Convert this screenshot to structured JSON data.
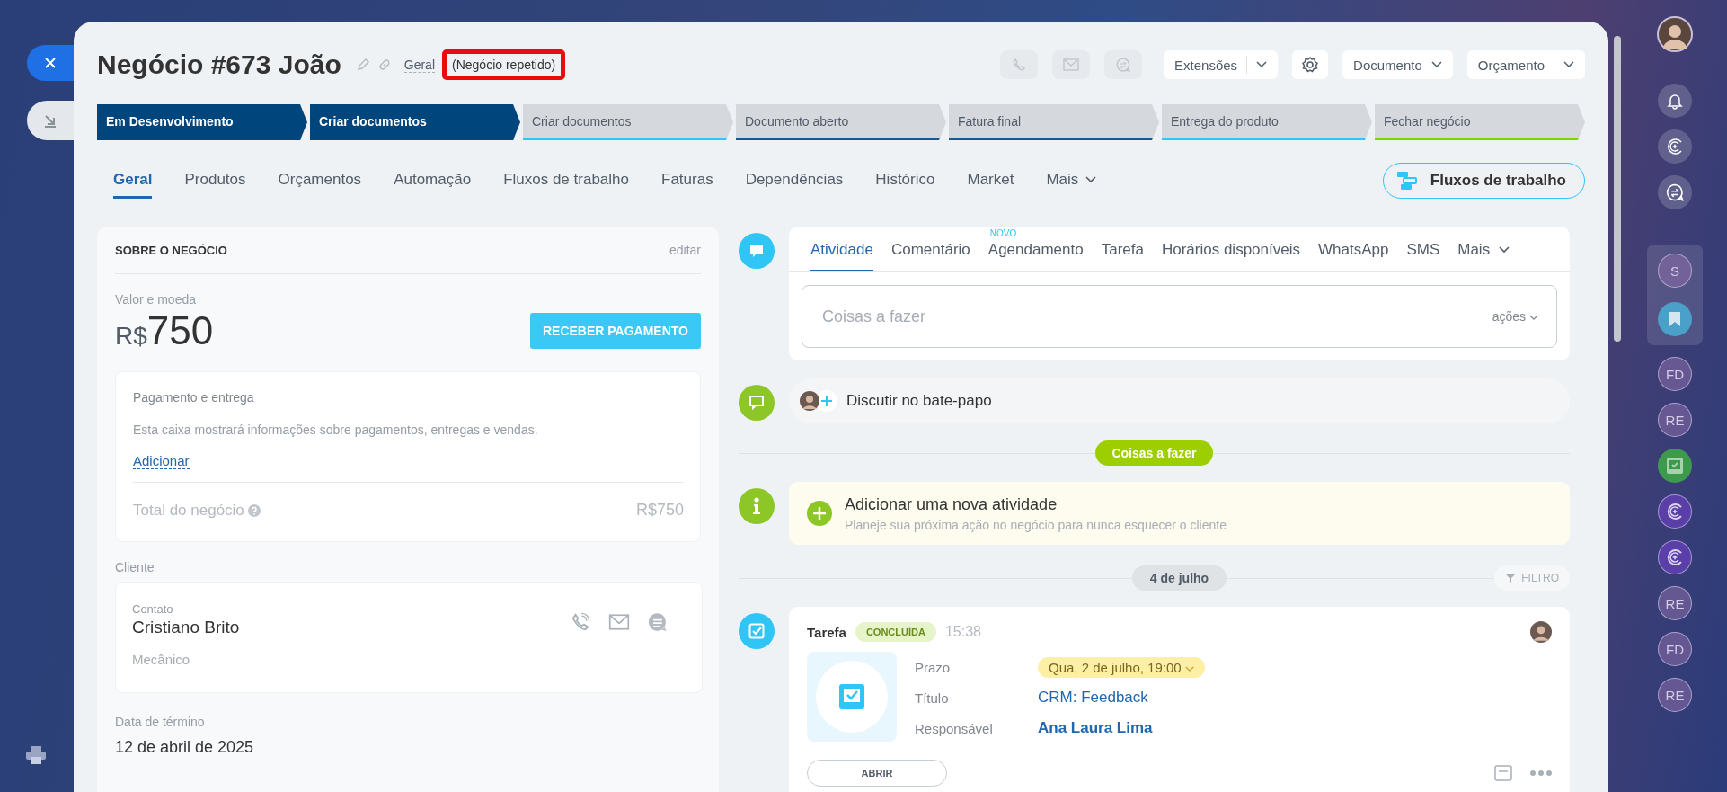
{
  "deal": {
    "title": "Negócio #673 João",
    "category": "Geral",
    "repeat_label": "(Negócio repetido)"
  },
  "header_actions": [
    {
      "kind": "phone",
      "disabled": true
    },
    {
      "kind": "mail",
      "disabled": true
    },
    {
      "kind": "chat",
      "disabled": true
    }
  ],
  "header_buttons": [
    {
      "kind": "split",
      "label": "Extensões"
    },
    {
      "kind": "gear"
    },
    {
      "kind": "dropdown",
      "label": "Documento"
    },
    {
      "kind": "split",
      "label": "Orçamento"
    }
  ],
  "stages": [
    {
      "label": "Em Desenvolvimento",
      "filled": true,
      "color": "#00457c"
    },
    {
      "label": "Criar documentos",
      "filled": true,
      "color": "#00457c"
    },
    {
      "label": "Criar documentos",
      "filled": false,
      "color": "#2fc6f6"
    },
    {
      "label": "Documento aberto",
      "filled": false,
      "color": "#1c5a8c"
    },
    {
      "label": "Fatura final",
      "filled": false,
      "color": "#1c5a8c"
    },
    {
      "label": "Entrega do produto",
      "filled": false,
      "color": "#2fc6f6"
    },
    {
      "label": "Fechar negócio",
      "filled": false,
      "color": "#7bd500"
    }
  ],
  "tabs": [
    {
      "label": "Geral",
      "selected": true
    },
    {
      "label": "Produtos",
      "selected": false
    },
    {
      "label": "Orçamentos",
      "selected": false
    },
    {
      "label": "Automação",
      "selected": false
    },
    {
      "label": "Fluxos de trabalho",
      "selected": false
    },
    {
      "label": "Faturas",
      "selected": false
    },
    {
      "label": "Dependências",
      "selected": false
    },
    {
      "label": "Histórico",
      "selected": false
    },
    {
      "label": "Market",
      "selected": false
    },
    {
      "label": "Mais",
      "selected": false
    }
  ],
  "workflows_button": "Fluxos de trabalho",
  "about": {
    "heading": "SOBRE O NEGÓCIO",
    "edit": "editar",
    "amount_label": "Valor e moeda",
    "currency": "R$",
    "amount": "750",
    "pay_button": "RECEBER PAGAMENTO",
    "payment": {
      "title": "Pagamento e entrega",
      "description": "Esta caixa mostrará informações sobre pagamentos, entregas e vendas.",
      "add_link": "Adicionar",
      "total_label": "Total do negócio",
      "total": "R$750"
    },
    "client_label": "Cliente",
    "contact": {
      "type": "Contato",
      "name": "Cristiano Brito",
      "role": "Mecânico"
    },
    "end_date_label": "Data de término",
    "end_date": "12 de abril de 2025"
  },
  "activity_tabs": [
    {
      "label": "Atividade",
      "selected": true
    },
    {
      "label": "Comentário",
      "selected": false
    },
    {
      "label": "Agendamento",
      "selected": false,
      "badge": "NOVO"
    },
    {
      "label": "Tarefa",
      "selected": false
    },
    {
      "label": "Horários disponíveis",
      "selected": false
    },
    {
      "label": "WhatsApp",
      "selected": false
    },
    {
      "label": "SMS",
      "selected": false
    },
    {
      "label": "Mais",
      "selected": false
    }
  ],
  "todo_input": {
    "placeholder": "Coisas a fazer",
    "actions": "ações"
  },
  "chat_row": "Discutir no bate-papo",
  "todo_divider": "Coisas a fazer",
  "new_activity": {
    "title": "Adicionar uma nova atividade",
    "hint": "Planeje sua próxima ação no negócio para nunca esquecer o cliente"
  },
  "date_divider": "4 de julho",
  "filter": "FILTRO",
  "task": {
    "type": "Tarefa",
    "status": "CONCLUÍDA",
    "time": "15:38",
    "fields": [
      {
        "kind": "pill",
        "label": "Prazo",
        "value": "Qua, 2 de julho, 19:00"
      },
      {
        "kind": "link",
        "label": "Título",
        "value": "CRM: Feedback"
      },
      {
        "kind": "person",
        "label": "Responsável",
        "value": "Ana Laura Lima"
      }
    ],
    "open_button": "ABRIR"
  },
  "sidebar": {
    "top": [
      {
        "kind": "bell"
      },
      {
        "kind": "copilot"
      },
      {
        "kind": "chat"
      }
    ],
    "pinned": [
      {
        "kind": "initials",
        "text": "S"
      },
      {
        "kind": "bookmark"
      }
    ],
    "items": [
      {
        "kind": "initials",
        "text": "FD"
      },
      {
        "kind": "initials",
        "text": "RE"
      },
      {
        "kind": "task"
      },
      {
        "kind": "copilot"
      },
      {
        "kind": "copilot"
      },
      {
        "kind": "initials",
        "text": "RE"
      },
      {
        "kind": "initials",
        "text": "FD"
      },
      {
        "kind": "initials",
        "text": "RE"
      }
    ]
  }
}
